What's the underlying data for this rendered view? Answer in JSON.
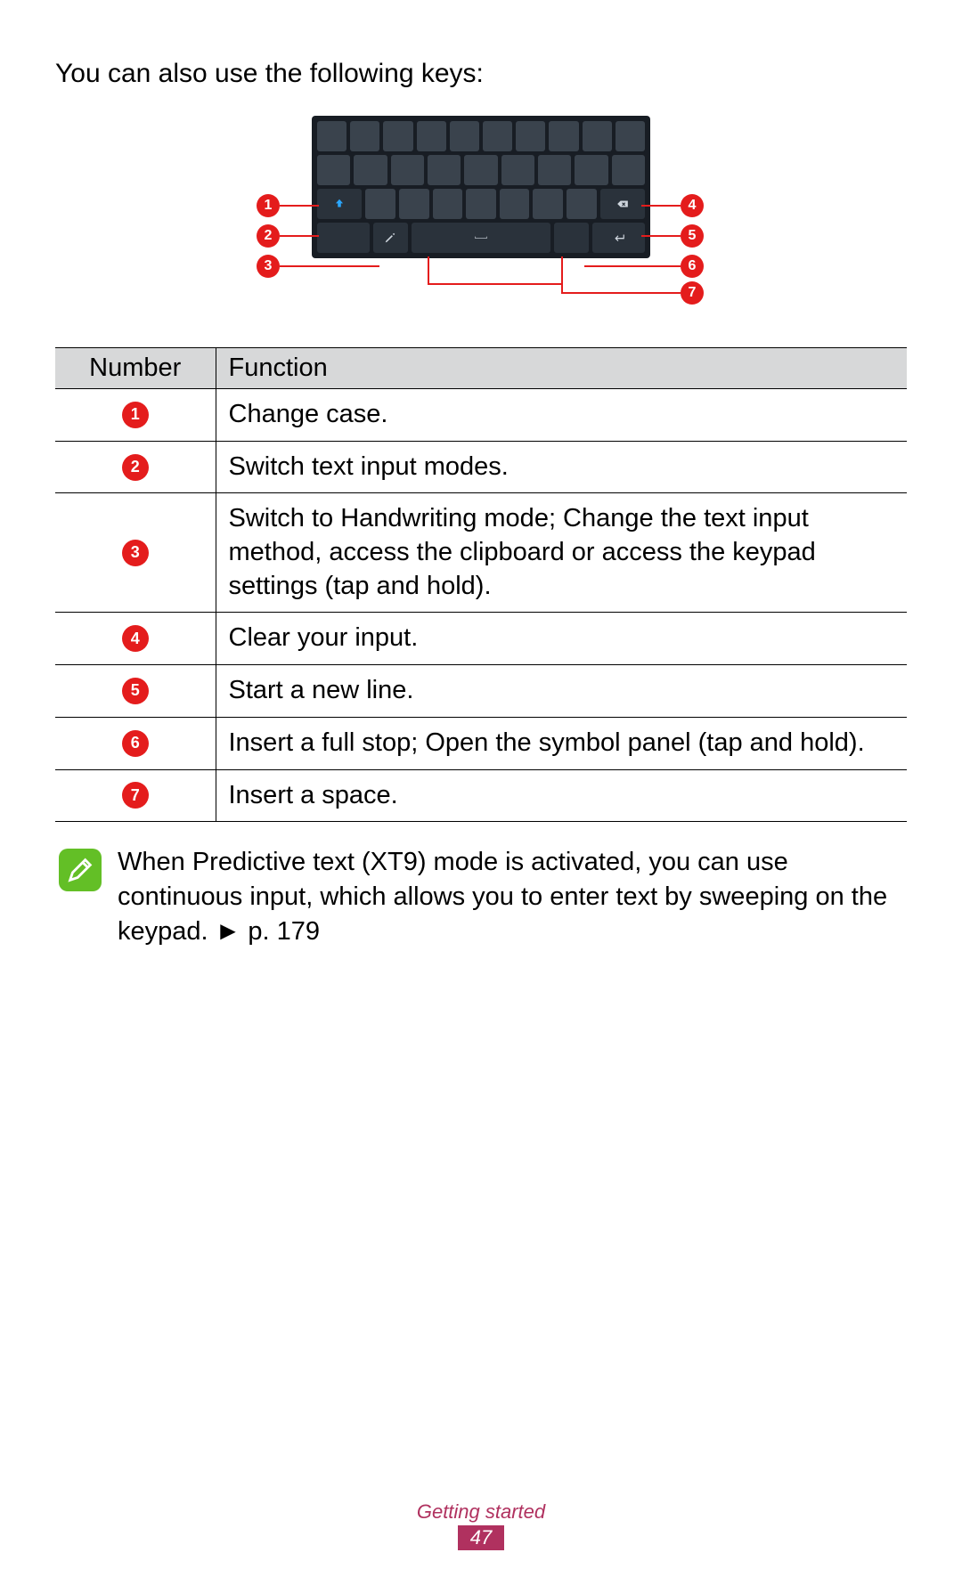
{
  "intro": "You can also use the following keys:",
  "callouts": {
    "left": [
      "1",
      "2",
      "3"
    ],
    "right": [
      "4",
      "5",
      "6"
    ],
    "bottom": "7"
  },
  "table": {
    "headers": {
      "number": "Number",
      "function": "Function"
    },
    "rows": [
      {
        "num": "1",
        "func": "Change case."
      },
      {
        "num": "2",
        "func": "Switch text input modes."
      },
      {
        "num": "3",
        "func": "Switch to Handwriting mode; Change the text input method, access the clipboard or access the keypad settings (tap and hold)."
      },
      {
        "num": "4",
        "func": "Clear your input."
      },
      {
        "num": "5",
        "func": "Start a new line."
      },
      {
        "num": "6",
        "func": "Insert a full stop; Open the symbol panel (tap and hold)."
      },
      {
        "num": "7",
        "func": "Insert a space."
      }
    ]
  },
  "note": "When Predictive text (XT9) mode is activated, you can use continuous input, which allows you to enter text by sweeping on the keypad. ► p. 179",
  "footer": {
    "section": "Getting started",
    "page": "47"
  }
}
